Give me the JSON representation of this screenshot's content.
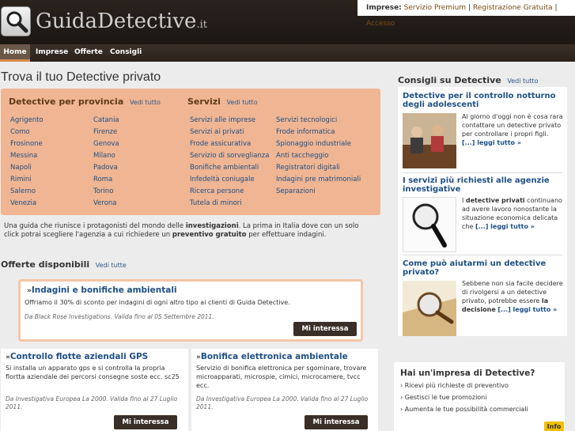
{
  "header": {
    "logo_main": "GuidaDetective",
    "logo_tld": ".it",
    "toplinks": {
      "label": "Imprese:",
      "items": [
        "Servizio Premium",
        "Registrazione Gratuita",
        "Accesso"
      ],
      "separator": " | "
    }
  },
  "nav": {
    "items": [
      "Home",
      "Imprese",
      "Offerte",
      "Consigli"
    ],
    "active": "Home"
  },
  "main": {
    "title": "Trova il tuo Detective privato",
    "province": {
      "heading": "Detective per provincia",
      "vedi": "Vedi tutto",
      "col1": [
        "Agrigento",
        "Como",
        "Frosinone",
        "Messina",
        "Napoli",
        "Rimini",
        "Salerno",
        "Venezia"
      ],
      "col2": [
        "Catania",
        "Firenze",
        "Genova",
        "Milano",
        "Padova",
        "Roma",
        "Torino",
        "Verona"
      ]
    },
    "servizi": {
      "heading": "Servizi",
      "vedi": "Vedi tutto",
      "col1": [
        "Servizi alle imprese",
        "Servizi ai privati",
        "Frode assicurativa",
        "Servizio di sorveglianza",
        "Bonifiche ambientali",
        "Infedeltà coniugale",
        "Ricerca persone",
        "Tutela di minori"
      ],
      "col2": [
        "Servizi tecnologici",
        "Frode informatica",
        "Spionaggio industriale",
        "Anti taccheggio",
        "Registratori digitali",
        "Indagini pre matrimoniali",
        "Separazioni"
      ]
    },
    "intro": {
      "p1": "Una guida che riunisce i protagonisti del mondo delle ",
      "b1": "investigazioni",
      "p2": ". La prima in Italia dove con un solo click potrai scegliere l'agenzia a cui richiedere un ",
      "b2": "preventivo gratuito",
      "p3": " per effettuare indagini."
    }
  },
  "offerte": {
    "heading": "Offerte disponibili",
    "vedi": "Vedi tutte",
    "arrow": "»",
    "featured": {
      "title": "Indagini e bonifiche ambientali",
      "body": "Offriamo il 30% di sconto per indagini di ogni altro tipo ai clienti di Guida Detective.",
      "source": "Da Black Rose Investigations. Valida fino al 05 Settembre 2011.",
      "button": "Mi interessa"
    },
    "cards": [
      {
        "title": "Controllo flotte aziendali GPS",
        "body": "Si installa un apparato gps e si controlla la propria flortta aziendale dei percorsi consegne soste ecc. sc25",
        "source": "Da Investigativa Europea La 2000. Valida fino al 27 Luglio 2011.",
        "button": "Mi interessa"
      },
      {
        "title": "Bonifica elettronica ambientale",
        "body": "Servizio di bonifica elettronica per sgominare, trovare microapparati, microspie, cimici, microcamere, tvcc ecc.",
        "source": "Da Investigativa Europea La 2000. Valida fino al 27 Luglio 2011.",
        "button": "Mi interessa"
      }
    ]
  },
  "consigli": {
    "heading": "Consigli su Detective",
    "vedi": "Vedi tutto",
    "articles": [
      {
        "title": "Detective per il controllo notturno degli adolescenti",
        "text": "Al giorno d'oggi non è cosa rara contattare un detective privato per controllare i propri figli.",
        "more": "[...] leggi tutto »"
      },
      {
        "title": "I servizi più richiesti alle agenzie investigative",
        "text_pre": "I ",
        "text_bold": "detective privati",
        "text_post": " continuano ad avere lavoro nonostante la situazione economica delicata che",
        "more": "[...] leggi tutto »"
      },
      {
        "title": "Come può aiutarmi un detective privato?",
        "text": "Sebbene non sia facile decidere di rivolgersi a un detective privato, potrebbe essere ",
        "text_bold": "la decisione",
        "more": "[...] leggi tutto »"
      }
    ]
  },
  "business": {
    "heading": "Hai un'impresa di Detective?",
    "items": [
      "Ricevi più richieste di preventivo",
      "Gestisci le tue promozioni",
      "Aumenta le tue possibilità commerciali"
    ],
    "info": "Info"
  }
}
